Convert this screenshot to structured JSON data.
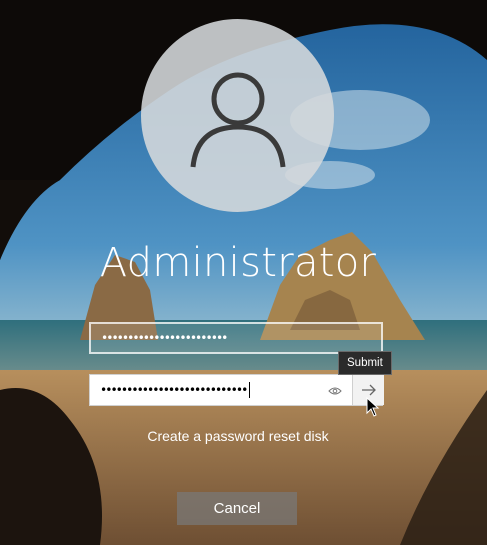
{
  "user": {
    "name": "Administrator"
  },
  "fields": {
    "current_password": {
      "masked_value": "••••••••••••••••••••••••"
    },
    "new_password": {
      "masked_value": "••••••••••••••••••••••••••••"
    }
  },
  "buttons": {
    "submit_tooltip": "Submit",
    "cancel_label": "Cancel"
  },
  "links": {
    "reset_disk": "Create a password reset disk"
  },
  "icons": {
    "avatar": "user-icon",
    "reveal": "eye-icon",
    "submit": "arrow-right-icon",
    "pointer": "mouse-cursor-icon"
  },
  "colors": {
    "avatar_bg": "#d6dadc",
    "cancel_bg": "#787878",
    "tooltip_bg": "#2b2b2b"
  }
}
